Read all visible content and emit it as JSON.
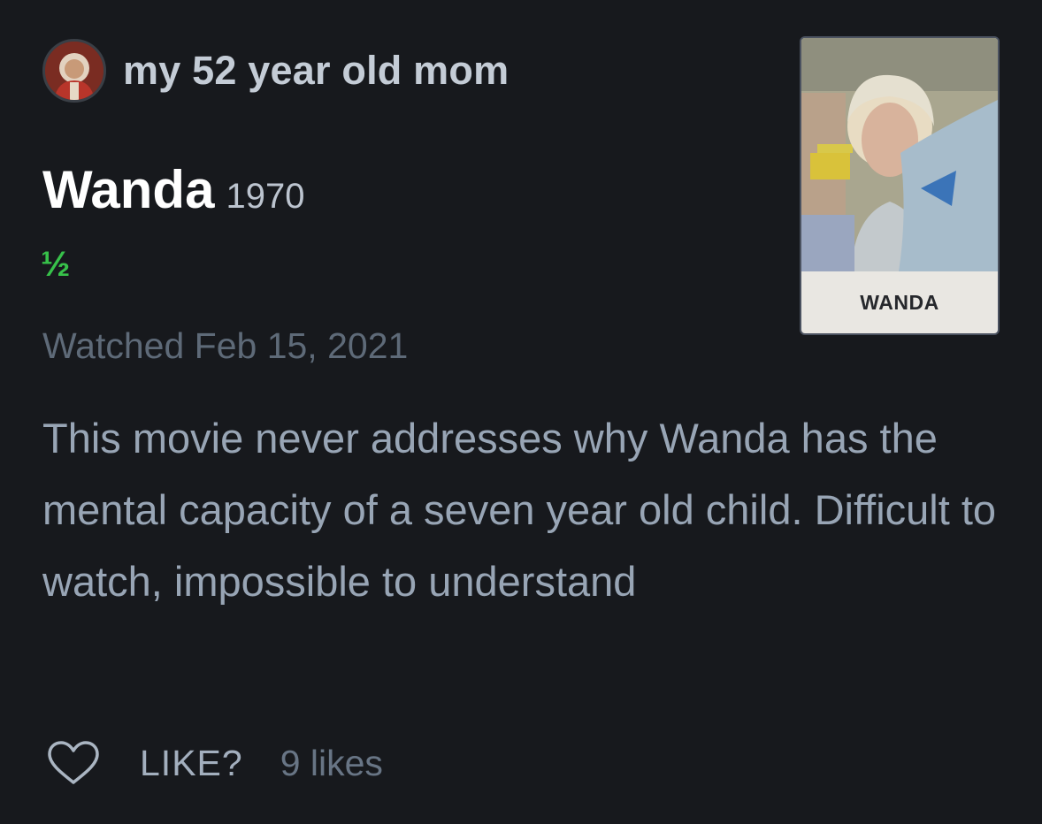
{
  "author": {
    "name": "my 52 year old mom",
    "avatar_icon": "user-avatar"
  },
  "film": {
    "title": "Wanda",
    "year": "1970",
    "poster_caption": "WANDA"
  },
  "rating": {
    "display": "½",
    "stars": 0.5,
    "max_stars": 5,
    "color": "#37c14a"
  },
  "watched": "Watched Feb 15, 2021",
  "review": {
    "text": "This movie never addresses why Wanda has the mental capacity of a seven year old child. Difficult to watch, impossible to understand"
  },
  "actions": {
    "like_icon": "heart-icon",
    "like_label": "LIKE?",
    "likes_count": "9 likes"
  },
  "colors": {
    "background": "#17191d",
    "accent_green": "#37c14a"
  }
}
